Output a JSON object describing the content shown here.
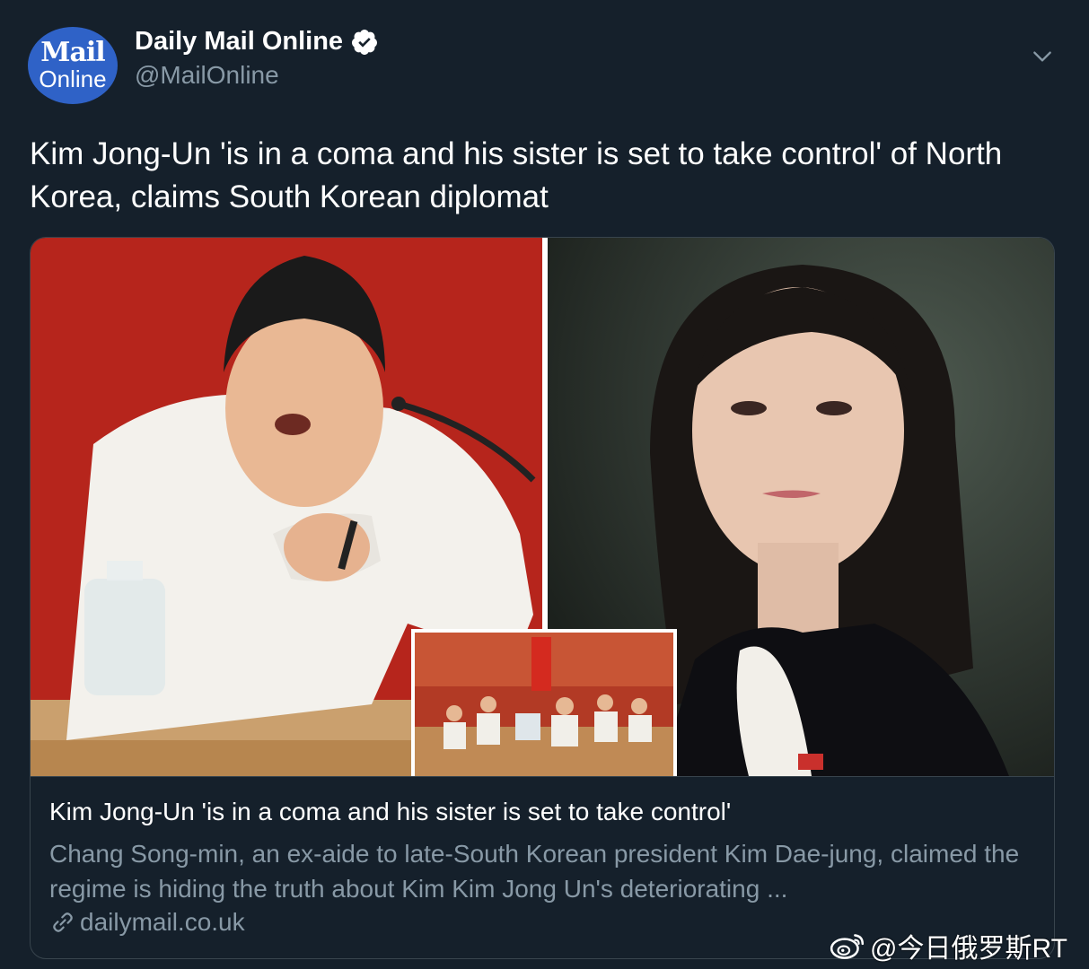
{
  "author": {
    "avatar_line1": "Mail",
    "avatar_line2": "Online",
    "display_name": "Daily Mail Online",
    "handle": "@MailOnline",
    "verified": true
  },
  "tweet": {
    "text": "Kim Jong-Un 'is in a coma and his sister is set to take control' of North Korea, claims South Korean diplomat"
  },
  "card": {
    "title": "Kim Jong-Un 'is in a coma and his sister is set to take control'",
    "description": "Chang Song-min, an ex-aide to late-South Korean president Kim Dae-jung, claimed the regime is hiding the truth about Kim Kim Jong Un's deteriorating ...",
    "domain": "dailymail.co.uk"
  },
  "watermark": {
    "text": "@今日俄罗斯RT"
  },
  "icons": {
    "verified": "verified-badge-icon",
    "menu": "chevron-down-icon",
    "link": "link-icon",
    "watermark_logo": "weibo-logo-icon"
  },
  "colors": {
    "background": "#15202b",
    "secondary_text": "#8899a6",
    "border": "#38444d",
    "avatar": "#2f62c7"
  }
}
